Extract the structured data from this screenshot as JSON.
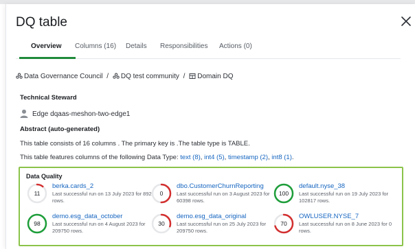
{
  "panel": {
    "title": "DQ table",
    "close_icon": "close-icon"
  },
  "tabs": [
    {
      "label": "Overview",
      "active": true
    },
    {
      "label": "Columns (16)",
      "active": false
    },
    {
      "label": "Details",
      "active": false
    },
    {
      "label": "Responsibilities",
      "active": false
    },
    {
      "label": "Actions (0)",
      "active": false
    }
  ],
  "breadcrumb": {
    "items": [
      {
        "label": "Data Governance Council",
        "icon": "community-icon"
      },
      {
        "label": "DQ test community",
        "icon": "community-icon"
      },
      {
        "label": "Domain DQ",
        "icon": "domain-icon"
      }
    ],
    "separator": "/"
  },
  "technical_steward": {
    "heading": "Technical Steward",
    "name": "Edge dqaas-meshon-two-edge1",
    "icon": "person-icon"
  },
  "abstract": {
    "heading": "Abstract (auto-generated)",
    "line1": "This table consists of 16 columns . The primary key is .The table type is TABLE.",
    "line2_prefix": "This table features columns of the following Data Type:",
    "data_types": [
      "text (8)",
      "int4 (5)",
      "timestamp (2)",
      "int8 (1)"
    ],
    "line2_suffix": "."
  },
  "data_quality": {
    "heading": "Data Quality",
    "colors": {
      "good": "#1e9e3a",
      "bad": "#d32f2f",
      "track": "#e6e7e9"
    },
    "items": [
      {
        "score": "11",
        "score_value": 11,
        "status": "bad",
        "name": "berka.cards_2",
        "desc": "Last successful run on 13 July 2023 for 892 rows."
      },
      {
        "score": "0",
        "score_value": 0,
        "status": "bad",
        "name": "dbo.CustomerChurnReporting",
        "desc": "Last successful run on 3 August 2023 for 60398 rows."
      },
      {
        "score": "100",
        "score_value": 100,
        "status": "good",
        "name": "default.nyse_38",
        "desc": "Last successful run on 19 July 2023 for 102817 rows."
      },
      {
        "score": "98",
        "score_value": 98,
        "status": "good",
        "name": "demo.esg_data_october",
        "desc": "Last successful run on 4 August 2023 for 209750 rows."
      },
      {
        "score": "30",
        "score_value": 30,
        "status": "bad",
        "name": "demo.esg_data_original",
        "desc": "Last successful run on 25 July 2023 for 209750 rows."
      },
      {
        "score": "70",
        "score_value": 70,
        "status": "bad",
        "name": "OWLUSER.NYSE_7",
        "desc": "Last successful run on 8 June 2023 for 0 rows."
      }
    ]
  }
}
